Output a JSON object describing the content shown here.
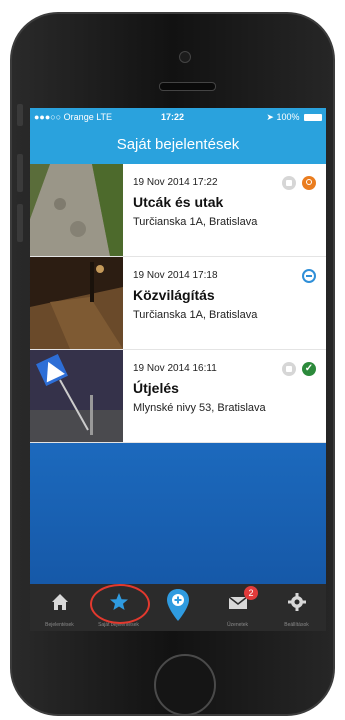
{
  "status_bar": {
    "carrier": "●●●○○ Orange  LTE",
    "time": "17:22",
    "battery": "100%"
  },
  "header": {
    "title": "Saját bejelentések"
  },
  "reports": [
    {
      "date": "19 Nov 2014 17:22",
      "title": "Utcák és utak",
      "address": "Turčianska 1A, Bratislava",
      "locked": true,
      "status": "orange-pin"
    },
    {
      "date": "19 Nov 2014 17:18",
      "title": "Közvilágítás",
      "address": "Turčianska 1A, Bratislava",
      "locked": false,
      "status": "blue-pending"
    },
    {
      "date": "19 Nov 2014 16:11",
      "title": "Útjelés",
      "address": "Mlynské nivy 53, Bratislava",
      "locked": true,
      "status": "green-check"
    }
  ],
  "tabbar": {
    "tabs": [
      {
        "label": "Bejelentések",
        "icon": "home-icon"
      },
      {
        "label": "Saját bejelentések",
        "icon": "star-icon",
        "active": true
      },
      {
        "label": "",
        "icon": "add-pin-icon"
      },
      {
        "label": "Üzenetek",
        "icon": "mail-icon",
        "badge": "2"
      },
      {
        "label": "Beállítások",
        "icon": "gear-icon"
      }
    ]
  },
  "colors": {
    "accent": "#2aa2dd",
    "active_tab": "#2f9be0",
    "annotation": "#e2392e"
  }
}
